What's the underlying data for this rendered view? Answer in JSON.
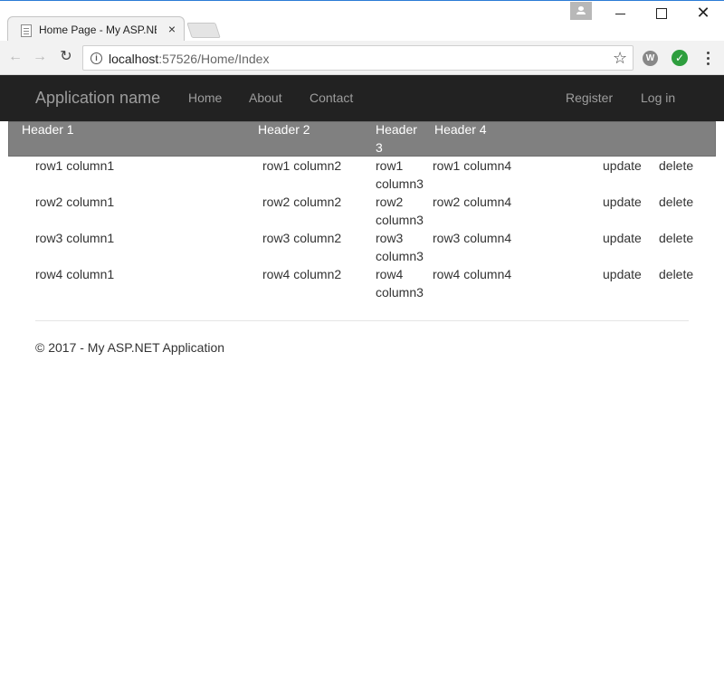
{
  "browser": {
    "tab_title": "Home Page - My ASP.NE",
    "tab_close": "×",
    "url_host": "localhost",
    "url_rest": ":57526/Home/Index",
    "window_close": "✕",
    "ext_w_label": "W",
    "ext_check_label": "✓"
  },
  "navbar": {
    "brand": "Application name",
    "links": [
      "Home",
      "About",
      "Contact"
    ],
    "right_links": [
      "Register",
      "Log in"
    ]
  },
  "table": {
    "headers": [
      "Header 1",
      "Header 2",
      "Header\n3",
      "Header 4"
    ],
    "rows": [
      {
        "c1": "row1 column1",
        "c2": "row1 column2",
        "c3": "row1\ncolumn3",
        "c4": "row1 column4"
      },
      {
        "c1": "row2 column1",
        "c2": "row2 column2",
        "c3": "row2\ncolumn3",
        "c4": "row2 column4"
      },
      {
        "c1": "row3 column1",
        "c2": "row3 column2",
        "c3": "row3\ncolumn3",
        "c4": "row3 column4"
      },
      {
        "c1": "row4 column1",
        "c2": "row4 column2",
        "c3": "row4\ncolumn3",
        "c4": "row4 column4"
      }
    ],
    "update_label": "update",
    "delete_label": "delete"
  },
  "footer": {
    "text": "© 2017 - My ASP.NET Application"
  },
  "colors": {
    "navbar_bg": "#222222",
    "navbar_text": "#9d9d9d",
    "table_header_bg": "#808080",
    "accent_border": "#2b7bd6"
  }
}
